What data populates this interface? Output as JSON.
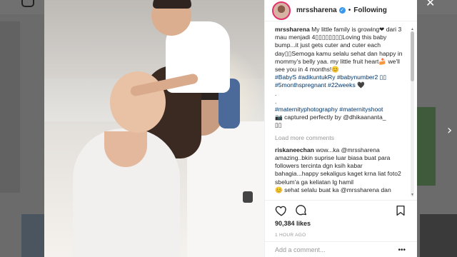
{
  "post": {
    "username": "mrssharena",
    "follow_label": "Following",
    "dot": "•",
    "verified_mark": "✓"
  },
  "caption": {
    "username": "mrssharena",
    "lines": [
      "My little family is growing❤ dari 3 mau menjadi 4▯▯▯▯▯▯▯▯Loving this baby bump...it just gets cuter and cuter each day▯▯Semoga kamu selalu sehat dan happy in mommy's belly yaa. my little fruit heart🍰 we'll see you in 4 months!😊"
    ],
    "hashtags_1": "#BabyS #adikuntukRy #babynumber2 ▯▯",
    "hashtags_2": "#5monthspregnant #22weeks 🖤",
    "dots": ".",
    "hashtags_3": "#maternityphotography #maternityshoot",
    "credit": "📷 captured perfectly by @dhikaananta_",
    "credit_tail": "▯▯"
  },
  "load_more": "Load more comments",
  "comment": {
    "username": "riskaneechan",
    "text": "wow...ka @mrssharena amazing..bkin suprise luar biasa buat para followers tercinta dgn ksih kabar bahagia...happy sekaligus kaget krna liat foto2 sbelum'a ga keliatan lg hamil",
    "tail": "😊 sehat selalu buat ka @mrssharena dan"
  },
  "likes": "90,384 likes",
  "time": "1 HOUR AGO",
  "add_comment_placeholder": "Add a comment...",
  "more_label": "•••",
  "icons": {
    "heart": "heart-icon",
    "comment": "comment-icon",
    "save": "bookmark-icon",
    "close": "close-icon",
    "next": "chevron-right-icon"
  },
  "colors": {
    "verified": "#3897f0",
    "link": "#003569",
    "muted": "#999999",
    "text": "#262626"
  },
  "nav": {
    "close_glyph": "✕",
    "next_glyph": "›"
  }
}
